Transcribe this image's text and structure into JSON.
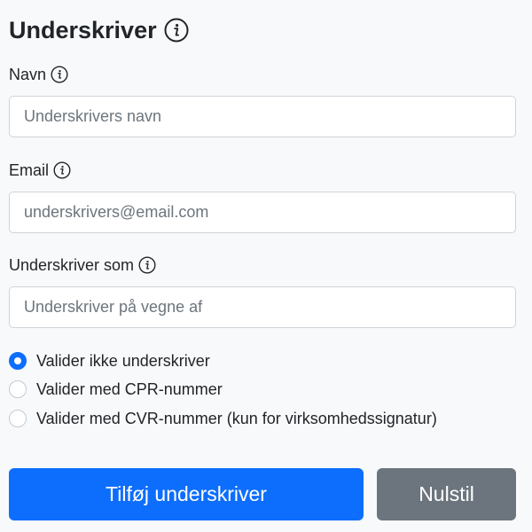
{
  "header": {
    "title": "Underskriver",
    "info_icon": "info-circle-icon"
  },
  "fields": {
    "name": {
      "label": "Navn",
      "placeholder": "Underskrivers navn",
      "value": ""
    },
    "email": {
      "label": "Email",
      "placeholder": "underskrivers@email.com",
      "value": ""
    },
    "signs_as": {
      "label": "Underskriver som",
      "placeholder": "Underskriver på vegne af",
      "value": ""
    }
  },
  "validation": {
    "selected_index": 0,
    "options": [
      {
        "label": "Valider ikke underskriver",
        "checked": true
      },
      {
        "label": "Valider med CPR-nummer",
        "checked": false
      },
      {
        "label": "Valider med CVR-nummer (kun for virksomhedssignatur)",
        "checked": false
      }
    ]
  },
  "actions": {
    "add_label": "Tilføj underskriver",
    "reset_label": "Nulstil"
  },
  "colors": {
    "primary": "#0d6efd",
    "secondary": "#6c757d",
    "background": "#f8f9fa",
    "input_border": "#ced4da"
  }
}
